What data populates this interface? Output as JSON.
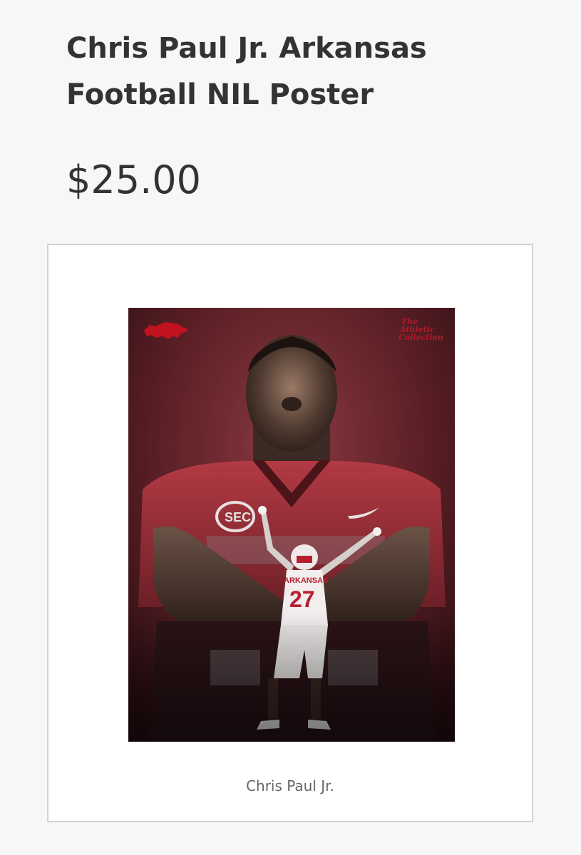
{
  "product": {
    "title": "Chris Paul Jr. Arkansas Football NIL Poster",
    "price": "$25.00"
  },
  "poster": {
    "caption": "Chris Paul Jr.",
    "brand_mark_lines": [
      "The",
      "Athletic",
      "Collection"
    ],
    "jersey_text": "ARKANSAS",
    "jersey_number": "27",
    "conference_patch": "SEC",
    "logo_icon": "razorback-hog-icon",
    "colors": {
      "brand_red": "#c1121f",
      "background": "#4e1a1f"
    }
  }
}
